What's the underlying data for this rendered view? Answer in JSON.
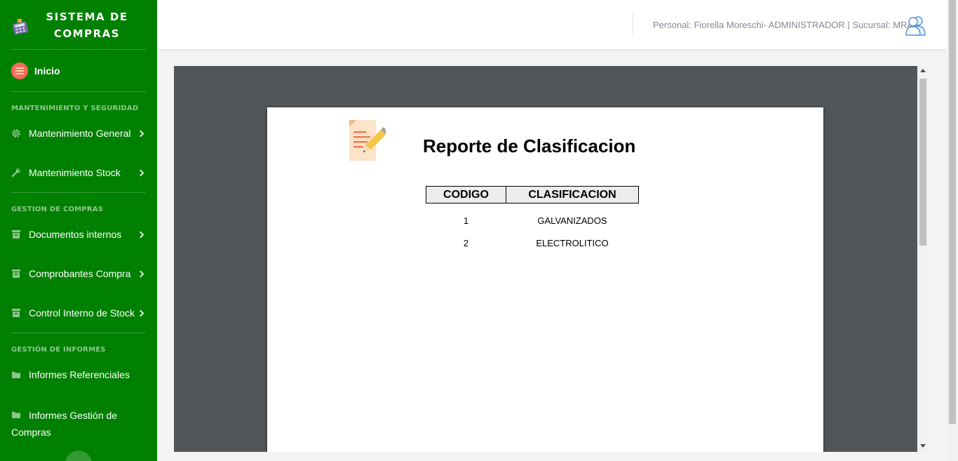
{
  "app": {
    "brand_title": "SISTEMA DE COMPRAS",
    "brand_icon": "calculator-icon"
  },
  "sidebar": {
    "home": {
      "label": "Inicio",
      "icon": "home-icon"
    },
    "sections": [
      {
        "heading": "MANTENIMIENTO Y SEGURIDAD"
      },
      {
        "heading": "GESTION DE COMPRAS"
      },
      {
        "heading": "GESTIÓN DE INFORMES"
      }
    ],
    "items": [
      {
        "label": "Mantenimiento General",
        "icon": "gear-icon"
      },
      {
        "label": "Mantenimiento Stock",
        "icon": "wrench-icon"
      },
      {
        "label": "Documentos internos",
        "icon": "archive-icon"
      },
      {
        "label": "Comprobantes Compra",
        "icon": "archive-icon"
      },
      {
        "label": "Control Interno de Stock",
        "icon": "archive-icon"
      },
      {
        "label": "Informes Referenciales",
        "icon": "folder-icon"
      },
      {
        "label": "Informes Gestión de Compras",
        "icon": "folder-icon"
      }
    ]
  },
  "topbar": {
    "user_info": "Personal: Fiorella Moreschi- ADMINISTRADOR | Sucursal: MRA",
    "avatar_icon": "users-icon"
  },
  "report": {
    "title": "Reporte de Clasificacion",
    "icon": "edit-document-icon",
    "columns": [
      "CODIGO",
      "CLASIFICACION"
    ],
    "rows": [
      [
        "1",
        "GALVANIZADOS"
      ],
      [
        "2",
        "ELECTROLITICO"
      ]
    ]
  },
  "colors": {
    "sidebar_bg": "#008000",
    "viewer_bg": "#525659"
  }
}
